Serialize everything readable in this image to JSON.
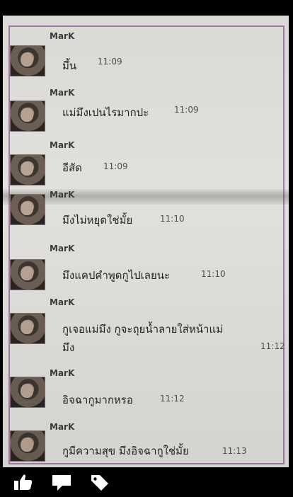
{
  "messages": [
    {
      "name": "MarK",
      "lines": [
        "มึ้น"
      ],
      "time": "11:09"
    },
    {
      "name": "MarK",
      "lines": [
        "แม่มึงเปนไรมากปะ"
      ],
      "time": "11:09"
    },
    {
      "name": "MarK",
      "lines": [
        "อีสัด"
      ],
      "time": "11:09"
    },
    {
      "name": "MarK",
      "lines": [
        "มึงไม่หยุดใช่มั้ย"
      ],
      "time": "11:10"
    },
    {
      "name": "MarK",
      "lines": [
        "มึงแคปคำพูดกูไปเลยนะ"
      ],
      "time": "11:10"
    },
    {
      "name": "MarK",
      "lines": [
        "กูเจอแม่มึง กูจะถุยน้ำลายใส่หน้าแม่",
        "มึง"
      ],
      "time": "11:12"
    },
    {
      "name": "MarK",
      "lines": [
        "อิจฉากูมากหรอ"
      ],
      "time": "11:12"
    },
    {
      "name": "MarK",
      "lines": [
        "กูมีความสุข มึงอิจฉากูใช่มั้ย"
      ],
      "time": "11:13"
    }
  ],
  "toolbar": {
    "icons": [
      "like-icon",
      "comment-icon",
      "tag-icon"
    ]
  }
}
